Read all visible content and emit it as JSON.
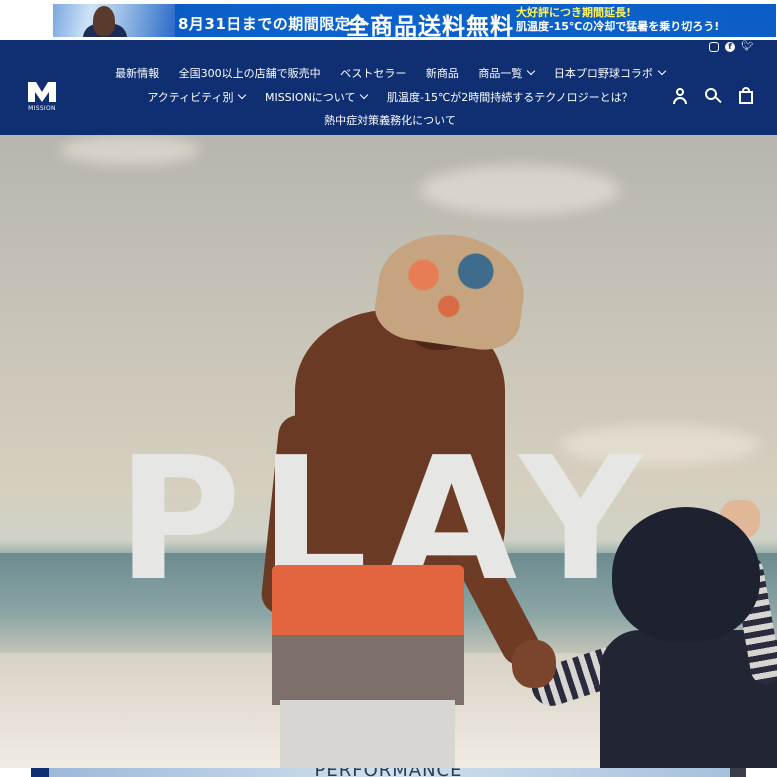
{
  "promo": {
    "line1": "8月31日までの期間限定で",
    "line2": "全商品送料無料",
    "note1": "大好評につき期間延長!",
    "note2": "肌温度-15℃の冷却で猛暑を乗り切ろう!"
  },
  "social": {
    "instagram": "instagram-icon",
    "facebook": "facebook-icon",
    "twitter": "twitter-icon"
  },
  "brand": {
    "logo_text": "MISSION"
  },
  "nav": {
    "row1": [
      {
        "label": "最新情報",
        "dropdown": false
      },
      {
        "label": "全国300以上の店舗で販売中",
        "dropdown": false
      },
      {
        "label": "ベストセラー",
        "dropdown": false
      },
      {
        "label": "新商品",
        "dropdown": false
      },
      {
        "label": "商品一覧",
        "dropdown": true
      },
      {
        "label": "日本プロ野球コラボ",
        "dropdown": true
      }
    ],
    "row2": [
      {
        "label": "アクティビティ別",
        "dropdown": true
      },
      {
        "label": "MISSIONについて",
        "dropdown": true
      },
      {
        "label": "肌温度-15℃が2時間持続するテクノロジーとは？",
        "dropdown": false
      }
    ],
    "row3": [
      {
        "label": "熱中症対策義務化について",
        "dropdown": false
      }
    ]
  },
  "header_icons": {
    "account": "user-icon",
    "search": "search-icon",
    "cart": "cart-icon"
  },
  "hero": {
    "headline": "PLAY"
  },
  "next_section": {
    "peek_text": "PERFORMANCE"
  },
  "colors": {
    "header_bg": "#0f2f72",
    "promo_bg": "#0b5ec6",
    "promo_accent": "#fff45a"
  }
}
